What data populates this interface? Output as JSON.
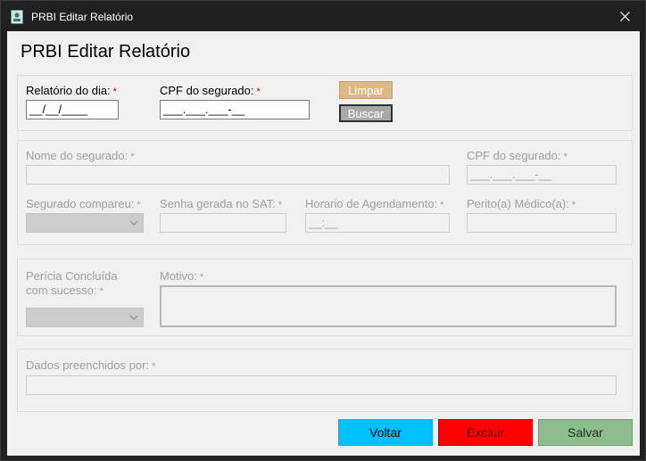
{
  "window": {
    "title": "PRBI Editar Relatório",
    "heading": "PRBI Editar Relatório"
  },
  "search": {
    "date_label": "Relatório do dia:",
    "date_value": "__/__/____",
    "cpf_label": "CPF do segurado:",
    "cpf_value": "___.___.___-__",
    "clear_label": "Limpar",
    "search_label": "Buscar",
    "required_mark": "*"
  },
  "details": {
    "name_label": "Nome do segurado:",
    "cpf_label": "CPF do segurado:",
    "cpf_value": "___.___.___-__",
    "attended_label": "Segurado compareu:",
    "sat_password_label": "Senha gerada no SAT:",
    "schedule_time_label": "Horario de Agendamento:",
    "schedule_time_value": "__:__",
    "doctor_label": "Perito(a) Médico(a):"
  },
  "outcome": {
    "completed_label_line1": "Perícia Concluída",
    "completed_label_line2": "com sucesso:",
    "reason_label": "Motivo:"
  },
  "filled_by": {
    "label": "Dados preenchidos por:"
  },
  "footer": {
    "back_label": "Voltar",
    "delete_label": "Excluir",
    "save_label": "Salvar"
  },
  "colors": {
    "back": "#00bfff",
    "delete": "#ff0000",
    "save": "#8fbc8f",
    "clear": "#deb887",
    "search": "#a9a9a9"
  }
}
